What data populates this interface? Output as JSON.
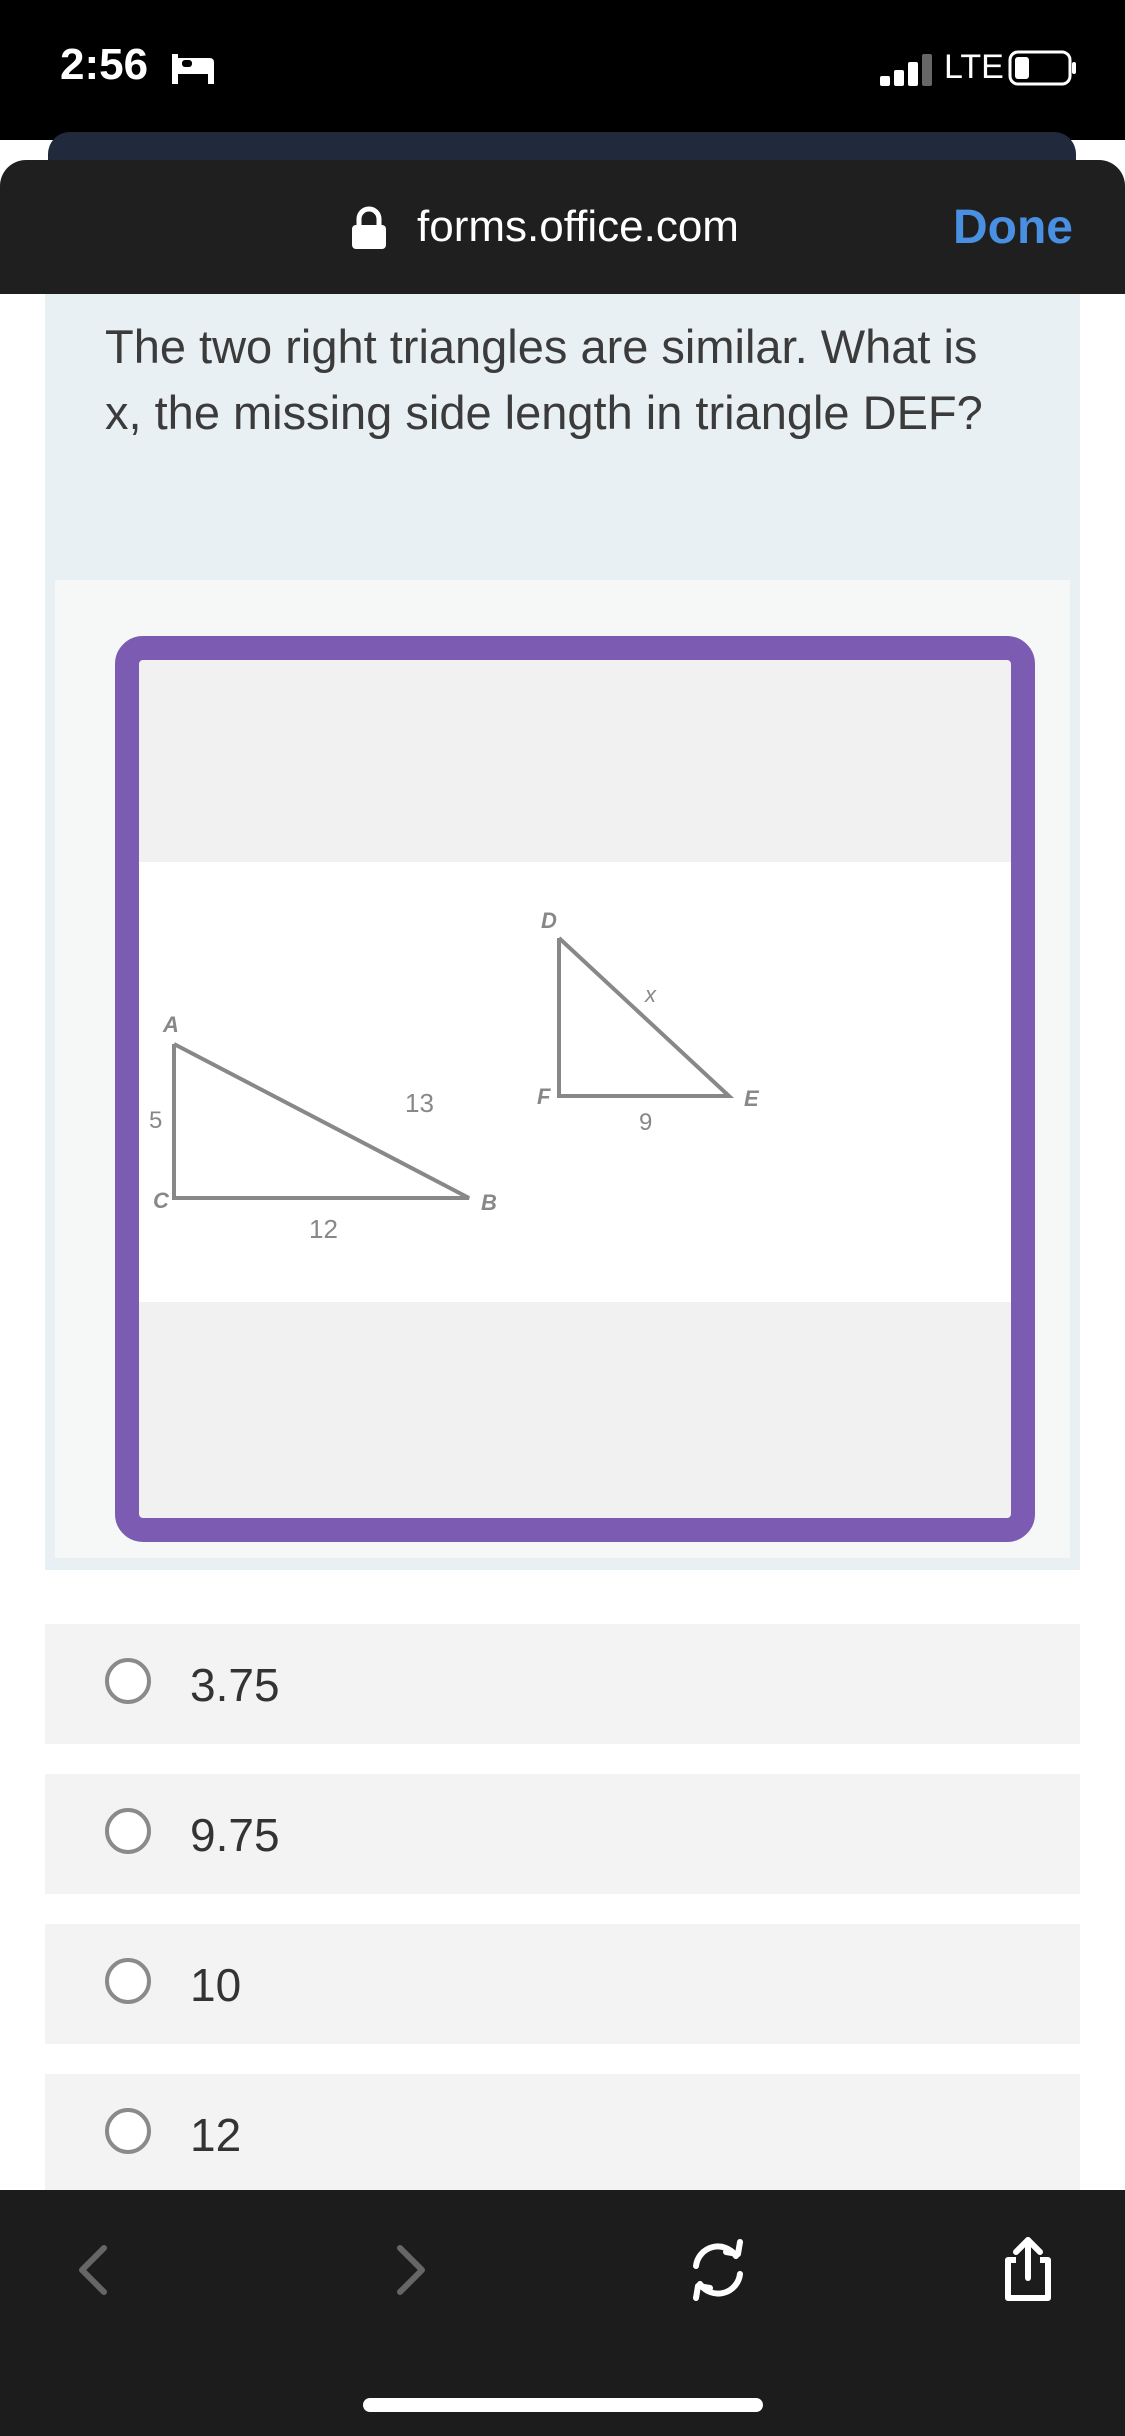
{
  "status_bar": {
    "time": "2:56",
    "network": "LTE",
    "icons": [
      "bed-icon",
      "signal-icon",
      "battery-icon"
    ]
  },
  "browser": {
    "url": "forms.office.com",
    "done_label": "Done",
    "icons": [
      "lock-icon",
      "back-icon",
      "forward-icon",
      "refresh-icon",
      "share-icon"
    ]
  },
  "question": {
    "text": "The two right triangles are similar. What is x, the missing side length in triangle DEF?"
  },
  "figure": {
    "triangle_abc": {
      "vertices": [
        "A",
        "B",
        "C"
      ],
      "sides": {
        "AC": "5",
        "AB": "13",
        "CB": "12"
      }
    },
    "triangle_def": {
      "vertices": [
        "D",
        "E",
        "F"
      ],
      "sides": {
        "DE": "x",
        "FE": "9"
      }
    }
  },
  "options": [
    {
      "label": "3.75",
      "selected": false
    },
    {
      "label": "9.75",
      "selected": false
    },
    {
      "label": "10",
      "selected": false
    },
    {
      "label": "12",
      "selected": false
    }
  ],
  "colors": {
    "accent": "#4a90e2",
    "frame": "#7c5cb2"
  }
}
